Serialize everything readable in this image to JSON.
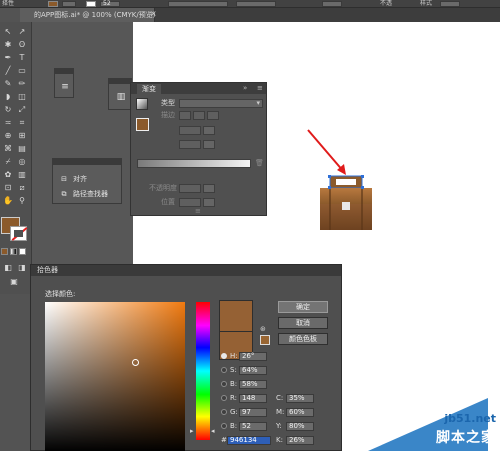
{
  "topbar": {
    "left_text": "择性",
    "stroke_field": "52",
    "opacity_label": "不透",
    "style_label": "样式"
  },
  "document_tab": {
    "title": "的APP图标.ai* @ 100% (CMYK/预览)",
    "close": "×"
  },
  "tools": {
    "icons": [
      "selection-tool",
      "direct-selection-tool",
      "magic-wand-tool",
      "lasso-tool",
      "pen-tool",
      "type-tool",
      "line-tool",
      "rectangle-tool",
      "paintbrush-tool",
      "pencil-tool",
      "blob-brush-tool",
      "eraser-tool",
      "rotate-tool",
      "scale-tool",
      "width-tool",
      "free-transform-tool",
      "shape-builder-tool",
      "perspective-tool",
      "mesh-tool",
      "gradient-tool",
      "eyedropper-tool",
      "blend-tool",
      "symbol-sprayer-tool",
      "column-graph-tool",
      "artboard-tool",
      "slice-tool",
      "hand-tool",
      "zoom-tool"
    ],
    "fill_color": "#8b5a2b"
  },
  "align_panel": {
    "items": [
      {
        "icon": "align-icon",
        "label": "对齐"
      },
      {
        "icon": "pathfinder-icon",
        "label": "路径查找器"
      }
    ]
  },
  "gradient_panel": {
    "tab": "渐变",
    "type_label": "类型",
    "stroke_label": "描边",
    "opacity_label": "不透明度",
    "position_label": "位置"
  },
  "color_picker": {
    "title": "拾色器",
    "select_color_label": "选择颜色:",
    "ok_button": "确定",
    "cancel_button": "取消",
    "swatches_button": "颜色色板",
    "new_color": "#956134",
    "fields": {
      "H": {
        "label": "H:",
        "value": "26°"
      },
      "S": {
        "label": "S:",
        "value": "64%"
      },
      "B": {
        "label": "B:",
        "value": "58%"
      },
      "R": {
        "label": "R:",
        "value": "148"
      },
      "G": {
        "label": "G:",
        "value": "97"
      },
      "Bl": {
        "label": "B:",
        "value": "52"
      },
      "C": {
        "label": "C:",
        "value": "35%"
      },
      "M": {
        "label": "M:",
        "value": "60%"
      },
      "Y": {
        "label": "Y:",
        "value": "80%"
      },
      "K": {
        "label": "K:",
        "value": "26%"
      },
      "hex": {
        "label": "#",
        "value": "946134"
      }
    }
  },
  "watermark": {
    "site": "jb51.net",
    "text": "脚本之家"
  }
}
